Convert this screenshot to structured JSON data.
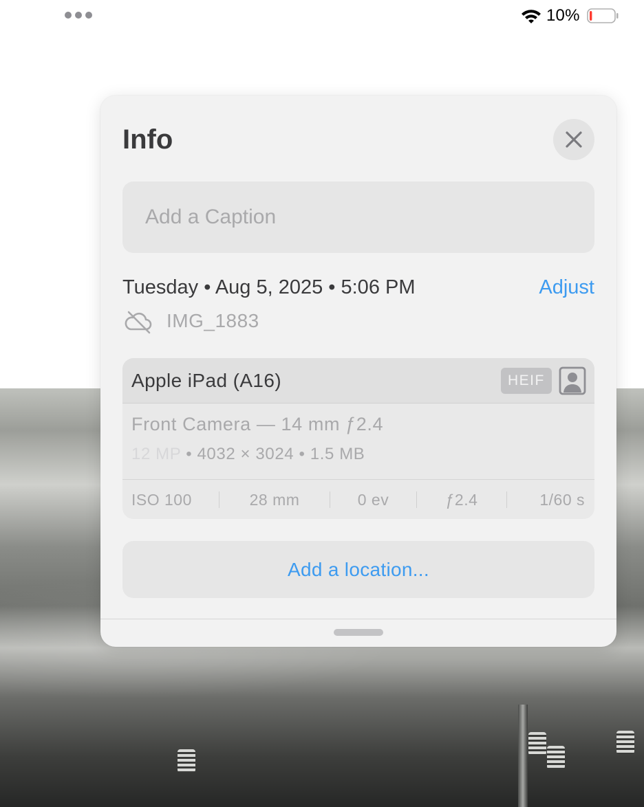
{
  "status_bar": {
    "battery_percent": "10%",
    "battery_level": 0.1,
    "icons": [
      "multitasking-dots-icon",
      "wifi-icon",
      "battery-icon"
    ]
  },
  "info_panel": {
    "title": "Info",
    "close_icon": "close-icon",
    "caption_placeholder": "Add a Caption",
    "date_line": "Tuesday • Aug 5, 2025 • 5:06 PM",
    "adjust_label": "Adjust",
    "cloud_icon": "cloud-slash-icon",
    "filename": "IMG_1883",
    "device": "Apple iPad (A16)",
    "format_badge": "HEIF",
    "portrait_icon": "portrait-icon",
    "camera": "Front Camera — 14 mm ƒ2.4",
    "megapixels": "12 MP",
    "resolution": "• 4032 × 3024 • 1.5 MB",
    "exif": [
      "ISO 100",
      "28 mm",
      "0 ev",
      "ƒ2.4",
      "1/60 s"
    ],
    "location_label": "Add a location..."
  },
  "colors": {
    "accent": "#3d9bf0",
    "battery_low": "#ff3b30",
    "panel_bg": "#f2f2f2"
  }
}
